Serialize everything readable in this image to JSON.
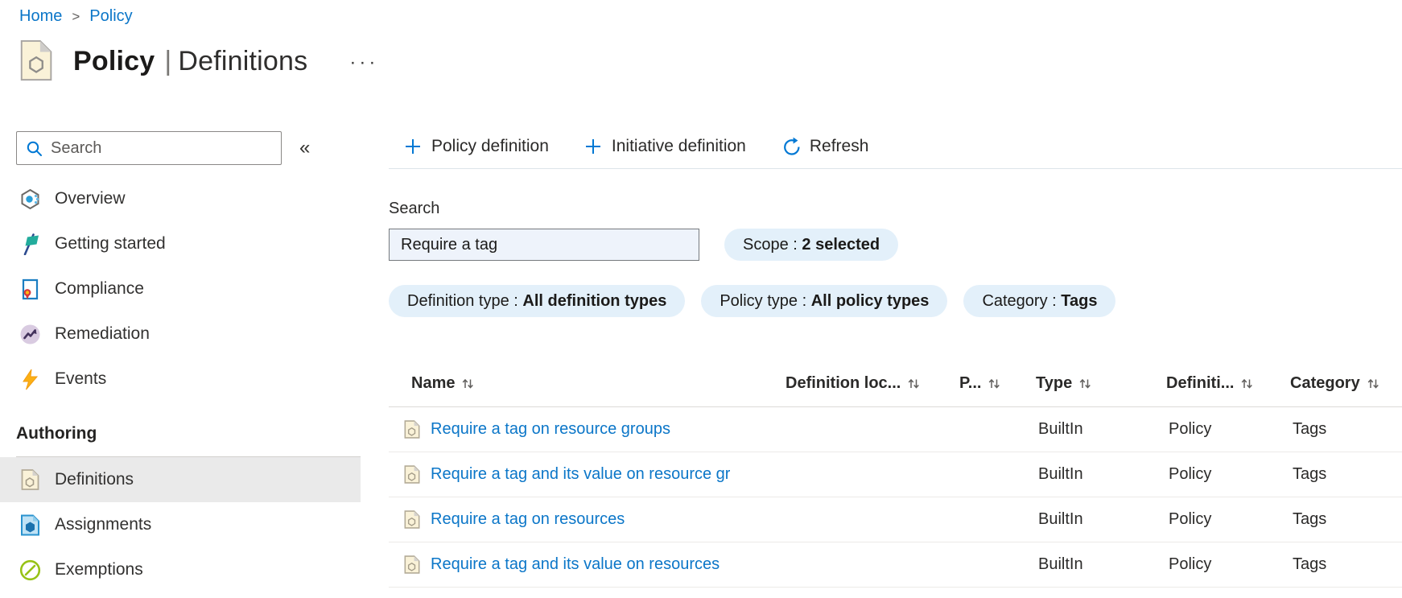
{
  "breadcrumb": {
    "separator": ">",
    "items": [
      {
        "label": "Home"
      },
      {
        "label": "Policy"
      }
    ]
  },
  "header": {
    "title": "Policy",
    "separator": "|",
    "subtitle": "Definitions",
    "more_glyph": "···"
  },
  "sidebar": {
    "search_placeholder": "Search",
    "collapse_glyph": "«",
    "items": [
      {
        "label": "Overview",
        "icon": "overview-icon"
      },
      {
        "label": "Getting started",
        "icon": "getting-started-icon"
      },
      {
        "label": "Compliance",
        "icon": "compliance-icon"
      },
      {
        "label": "Remediation",
        "icon": "remediation-icon"
      },
      {
        "label": "Events",
        "icon": "events-icon"
      }
    ],
    "section_label": "Authoring",
    "authoring_items": [
      {
        "label": "Definitions",
        "icon": "definitions-icon",
        "selected": true
      },
      {
        "label": "Assignments",
        "icon": "assignments-icon",
        "selected": false
      },
      {
        "label": "Exemptions",
        "icon": "exemptions-icon",
        "selected": false
      }
    ]
  },
  "toolbar": {
    "policy_definition_label": "Policy definition",
    "initiative_definition_label": "Initiative definition",
    "refresh_label": "Refresh"
  },
  "filters": {
    "search_label": "Search",
    "search_value": "Require a tag",
    "pill_separator": " : ",
    "pills": [
      {
        "label": "Scope",
        "value": "2 selected"
      },
      {
        "label": "Definition type",
        "value": "All definition types"
      },
      {
        "label": "Policy type",
        "value": "All policy types"
      },
      {
        "label": "Category",
        "value": "Tags"
      }
    ]
  },
  "table": {
    "columns": [
      {
        "label": "Name"
      },
      {
        "label": "Definition loc..."
      },
      {
        "label": "P..."
      },
      {
        "label": "Type"
      },
      {
        "label": "Definiti..."
      },
      {
        "label": "Category"
      }
    ],
    "rows": [
      {
        "name": "Require a tag on resource groups",
        "definition_location": "",
        "policies": "",
        "type": "BuiltIn",
        "definition_type": "Policy",
        "category": "Tags"
      },
      {
        "name": "Require a tag and its value on resource gr",
        "definition_location": "",
        "policies": "",
        "type": "BuiltIn",
        "definition_type": "Policy",
        "category": "Tags"
      },
      {
        "name": "Require a tag on resources",
        "definition_location": "",
        "policies": "",
        "type": "BuiltIn",
        "definition_type": "Policy",
        "category": "Tags"
      },
      {
        "name": "Require a tag and its value on resources",
        "definition_location": "",
        "policies": "",
        "type": "BuiltIn",
        "definition_type": "Policy",
        "category": "Tags"
      }
    ]
  },
  "colors": {
    "accent": "#0078d4",
    "link": "#0b76c8",
    "pill_bg": "#e3f0fa",
    "selected_item_bg": "#eaeaea",
    "text": "#323130"
  }
}
